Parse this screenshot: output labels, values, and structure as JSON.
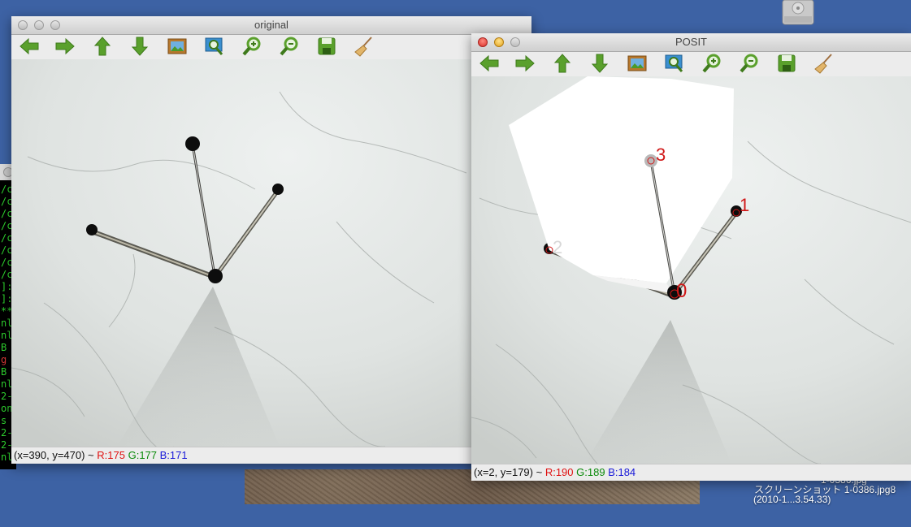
{
  "terminal": {
    "lines": [
      {
        "text": "/c",
        "color": "green"
      },
      {
        "text": "/c",
        "color": "green"
      },
      {
        "text": "/c",
        "color": "green"
      },
      {
        "text": "/c",
        "color": "green"
      },
      {
        "text": "/c",
        "color": "green"
      },
      {
        "text": "/c",
        "color": "green"
      },
      {
        "text": "/c",
        "color": "green"
      },
      {
        "text": "/c",
        "color": "green"
      },
      {
        "text": "]:",
        "color": "green"
      },
      {
        "text": "]:",
        "color": "green"
      },
      {
        "text": "**",
        "color": "green"
      },
      {
        "text": "nl",
        "color": "green"
      },
      {
        "text": "nl",
        "color": "green"
      },
      {
        "text": " B",
        "color": "green"
      },
      {
        "text": "g ",
        "color": "red"
      },
      {
        "text": " B",
        "color": "green"
      },
      {
        "text": "nl",
        "color": "green"
      },
      {
        "text": "2-",
        "color": "green"
      },
      {
        "text": "on",
        "color": "green"
      },
      {
        "text": " s",
        "color": "green"
      },
      {
        "text": "2-",
        "color": "green"
      },
      {
        "text": "2-",
        "color": "green"
      },
      {
        "text": "nl",
        "color": "green"
      }
    ]
  },
  "desktop": {
    "file_label_line1": "1-0386.jpg",
    "file_label_line2": "スクリーンショット  1-0386.jpg8",
    "file_label_line3": "(2010-1...3.54.33)",
    "colors": {
      "desktop": "#3d62a4"
    }
  },
  "toolbar_icons": [
    {
      "name": "arrow-left-icon"
    },
    {
      "name": "arrow-right-icon"
    },
    {
      "name": "arrow-up-icon"
    },
    {
      "name": "arrow-down-icon"
    },
    {
      "name": "image-icon"
    },
    {
      "name": "zoom-fit-icon"
    },
    {
      "name": "zoom-in-icon"
    },
    {
      "name": "zoom-out-icon"
    },
    {
      "name": "save-icon"
    },
    {
      "name": "broom-icon"
    }
  ],
  "window_original": {
    "title": "original",
    "status": {
      "coords": "(x=390, y=470) ~ ",
      "r": "R:175",
      "g": "G:177",
      "b": "B:171"
    }
  },
  "window_posit": {
    "title": "POSIT",
    "status": {
      "coords": "(x=2, y=179) ~ ",
      "r": "R:190",
      "g": "G:189",
      "b": "B:184"
    },
    "point_labels": [
      "0",
      "1",
      "2",
      "3"
    ]
  }
}
